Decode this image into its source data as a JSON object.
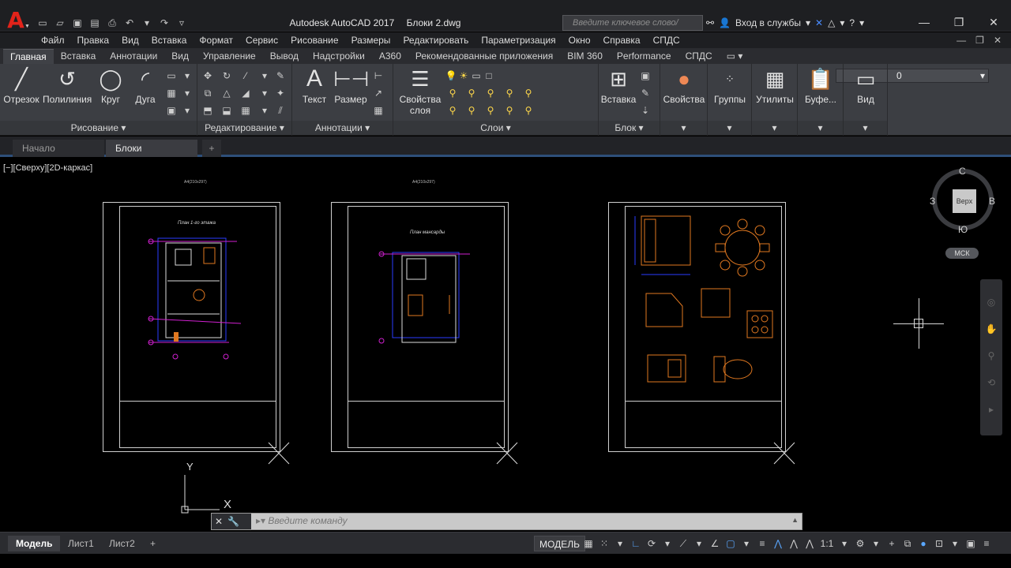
{
  "title": {
    "app": "Autodesk AutoCAD 2017",
    "file": "Блоки 2.dwg",
    "search_placeholder": "Введите ключевое слово/фразу",
    "signin": "Вход в службы"
  },
  "menu": [
    "Файл",
    "Правка",
    "Вид",
    "Вставка",
    "Формат",
    "Сервис",
    "Рисование",
    "Размеры",
    "Редактировать",
    "Параметризация",
    "Окно",
    "Справка",
    "СПДС"
  ],
  "ribbon_tabs": [
    "Главная",
    "Вставка",
    "Аннотации",
    "Вид",
    "Управление",
    "Вывод",
    "Надстройки",
    "A360",
    "Рекомендованные приложения",
    "BIM 360",
    "Performance",
    "СПДС"
  ],
  "ribbon": {
    "draw": {
      "title": "Рисование",
      "line": "Отрезок",
      "polyline": "Полилиния",
      "circle": "Круг",
      "arc": "Дуга"
    },
    "modify": {
      "title": "Редактирование"
    },
    "annotation": {
      "title": "Аннотации",
      "text": "Текст",
      "dimension": "Размер"
    },
    "layers": {
      "title": "Слои",
      "properties_line1": "Свойства",
      "properties_line2": "слоя",
      "current_layer": "0"
    },
    "block": {
      "title": "Блок",
      "insert": "Вставка"
    },
    "properties": {
      "label": "Свойства"
    },
    "groups": {
      "label": "Группы"
    },
    "utilities": {
      "label": "Утилиты"
    },
    "clipboard": {
      "label": "Буфе..."
    },
    "view": {
      "label": "Вид"
    }
  },
  "file_tabs": {
    "start": "Начало",
    "drawing": "Блоки 2*"
  },
  "viewport_label": "[−][Сверху][2D-каркас]",
  "sheets": [
    {
      "header": "А4(210x297)",
      "plan_title": "План 1-го этажа"
    },
    {
      "header": "А4(210x297)",
      "plan_title": "План мансарды"
    },
    {
      "header": "",
      "plan_title": ""
    }
  ],
  "viewcube": {
    "north": "С",
    "south": "Ю",
    "west": "З",
    "east": "В",
    "face": "Верх",
    "wcs": "МСК"
  },
  "ucs": {
    "x": "X",
    "y": "Y"
  },
  "command": {
    "placeholder": "Введите команду"
  },
  "layout_tabs": [
    "Модель",
    "Лист1",
    "Лист2"
  ],
  "status": {
    "model": "МОДЕЛЬ",
    "scale": "1:1"
  },
  "colors": {
    "accent": "#2e4f7a",
    "cad_magenta": "#d020d0",
    "cad_blue": "#2a3cff",
    "cad_orange": "#e07820"
  }
}
